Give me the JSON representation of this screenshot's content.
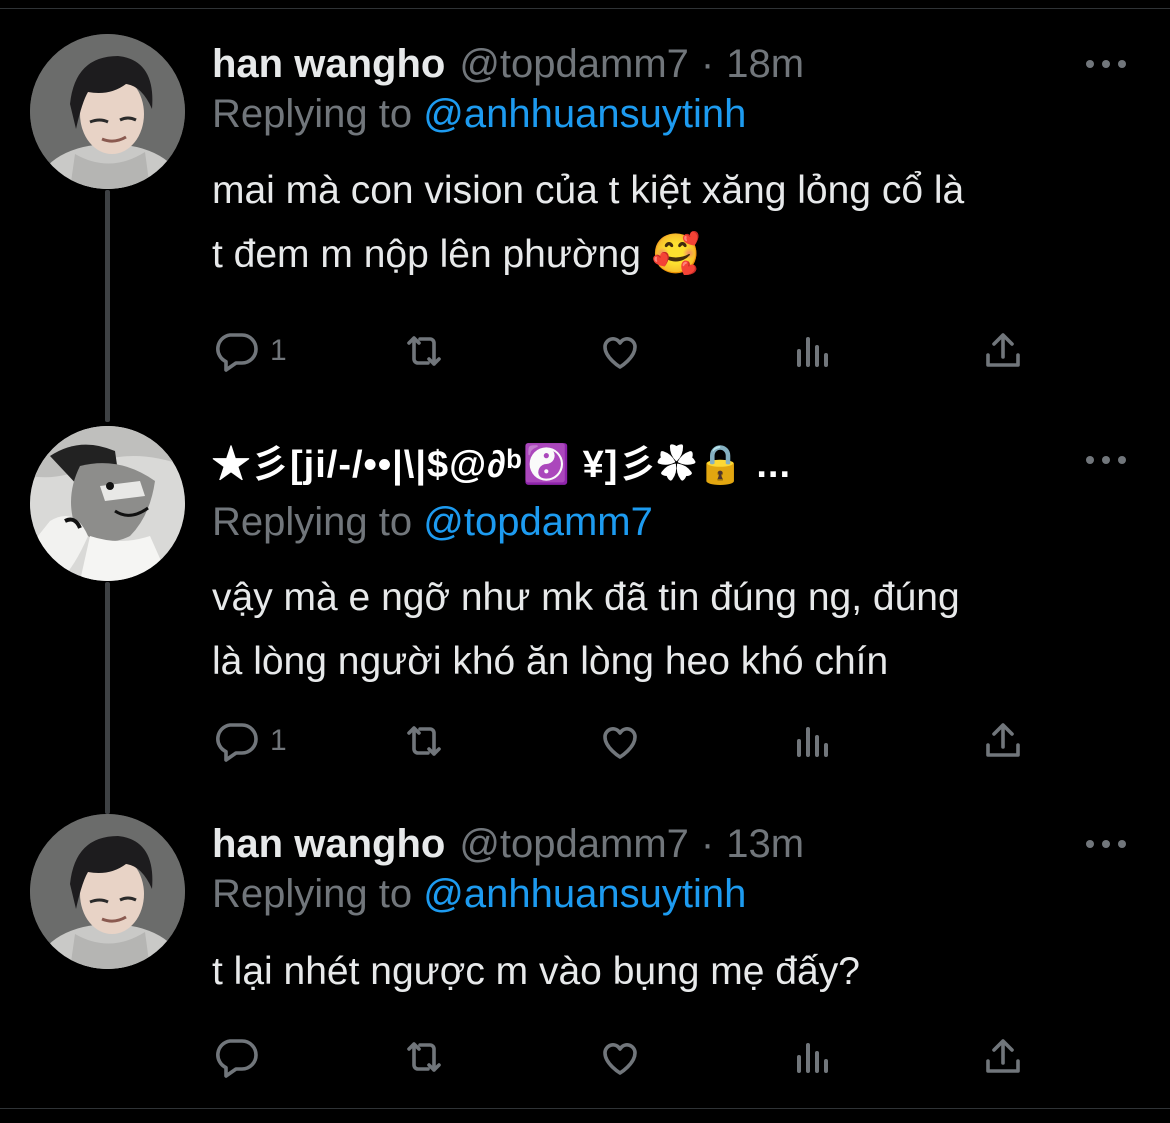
{
  "tweets": [
    {
      "name": "han wangho",
      "handle": "@topdamm7",
      "separator": "·",
      "time": "18m",
      "replying_prefix": "Replying to",
      "replying_to": "@anhhuansuytinh",
      "text_line1": "mai mà con vision của t kiệt xăng lỏng cổ là",
      "text_line2": "t đem m nộp lên phường 🥰",
      "reply_count": "1",
      "icons": [
        "reply-icon",
        "retweet-icon",
        "like-icon",
        "analytics-icon",
        "share-icon",
        "more-icon"
      ]
    },
    {
      "name": "★彡[ji/-/••|\\|$@∂ᵇ☯️ ¥]彡✿🔒 ...",
      "replying_prefix": "Replying to",
      "replying_to": "@topdamm7",
      "text_line1": "vậy mà e ngỡ như mk đã tin đúng ng, đúng",
      "text_line2": "là lòng người khó ăn lòng heo khó chín",
      "reply_count": "1",
      "icons": [
        "reply-icon",
        "retweet-icon",
        "like-icon",
        "analytics-icon",
        "share-icon",
        "more-icon"
      ]
    },
    {
      "name": "han wangho",
      "handle": "@topdamm7",
      "separator": "·",
      "time": "13m",
      "replying_prefix": "Replying to",
      "replying_to": "@anhhuansuytinh",
      "text_line1": "t lại nhét ngược m vào bụng mẹ đấy?",
      "reply_count": "",
      "icons": [
        "reply-icon",
        "retweet-icon",
        "like-icon",
        "analytics-icon",
        "share-icon",
        "more-icon"
      ]
    }
  ],
  "colors": {
    "background": "#000000",
    "text": "#e7e9ea",
    "muted": "#71767b",
    "link": "#1d9bf0"
  }
}
